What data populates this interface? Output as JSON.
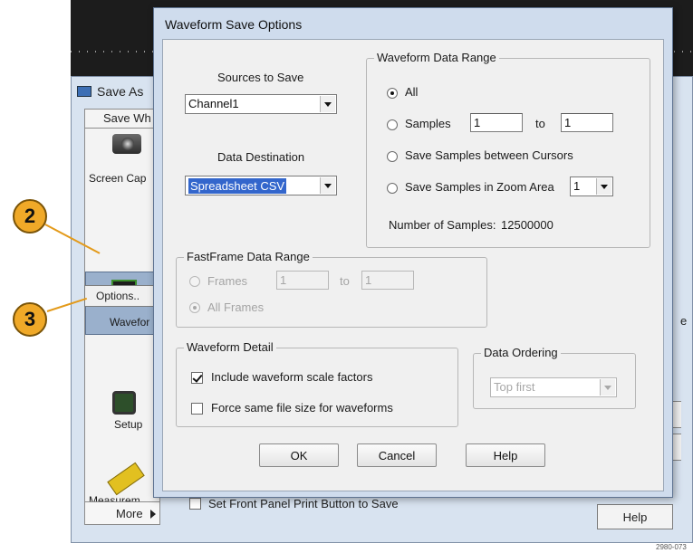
{
  "background_window": {
    "title": "Save As",
    "tab_label": "Save Wh",
    "items": [
      {
        "label": "Screen Cap",
        "icon": "camera-icon"
      },
      {
        "label": "Wavefor",
        "icon": "waveform-icon"
      },
      {
        "label": "Setup",
        "icon": "setup-icon"
      },
      {
        "label": "Measurem",
        "icon": "ruler-icon"
      }
    ],
    "options_label": "Options..",
    "more_label": "More",
    "front_panel_label": "Set Front Panel Print Button to Save",
    "help_label": "Help",
    "edge_fragment": "e"
  },
  "callouts": [
    "2",
    "3"
  ],
  "dialog": {
    "title": "Waveform Save Options",
    "sources": {
      "label": "Sources to Save",
      "value": "Channel1"
    },
    "destination": {
      "label": "Data Destination",
      "value": "Spreadsheet CSV"
    },
    "data_range": {
      "title": "Waveform Data Range",
      "all_label": "All",
      "samples_label": "Samples",
      "samples_from": "1",
      "to_label": "to",
      "samples_to": "1",
      "cursors_label": "Save Samples between Cursors",
      "zoom_label": "Save Samples in Zoom Area",
      "zoom_value": "1",
      "num_samples_label": "Number of Samples:",
      "num_samples_value": "12500000",
      "selected": "All"
    },
    "fastframe": {
      "title": "FastFrame Data Range",
      "frames_label": "Frames",
      "frames_from": "1",
      "to_label": "to",
      "frames_to": "1",
      "all_frames_label": "All Frames"
    },
    "waveform_detail": {
      "title": "Waveform Detail",
      "include_scale_label": "Include waveform scale factors",
      "include_scale_checked": true,
      "force_size_label": "Force same file size for waveforms",
      "force_size_checked": false
    },
    "data_ordering": {
      "title": "Data Ordering",
      "value": "Top first"
    },
    "buttons": {
      "ok": "OK",
      "cancel": "Cancel",
      "help": "Help"
    }
  },
  "figure_id": "2980-073"
}
